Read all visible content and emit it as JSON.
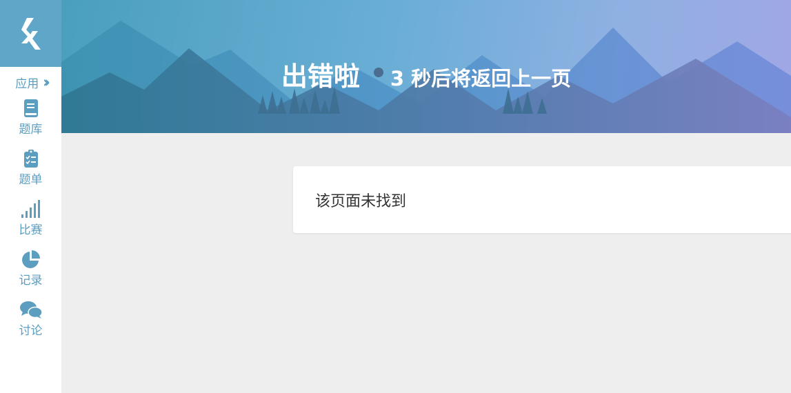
{
  "sidebar": {
    "apps_label": "应用",
    "items": [
      {
        "label": "题库",
        "icon": "book-icon"
      },
      {
        "label": "题单",
        "icon": "clipboard-list-icon"
      },
      {
        "label": "比赛",
        "icon": "signal-bars-icon"
      },
      {
        "label": "记录",
        "icon": "pie-chart-icon"
      },
      {
        "label": "讨论",
        "icon": "chat-bubbles-icon"
      }
    ]
  },
  "banner": {
    "title": "出错啦",
    "countdown": "3 秒后将返回上一页"
  },
  "message": {
    "text": "该页面未找到"
  },
  "colors": {
    "accent": "#5fa6c8",
    "nav_text": "#5c9ec0",
    "page_bg": "#eeeeee"
  }
}
